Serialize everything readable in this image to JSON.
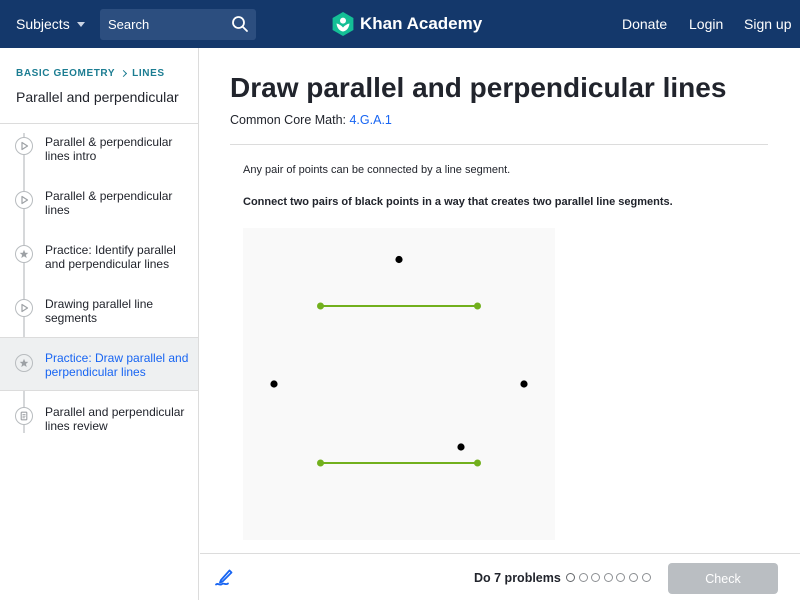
{
  "nav": {
    "subjects_label": "Subjects",
    "search_placeholder": "Search",
    "logo_text": "Khan Academy",
    "donate_label": "Donate",
    "login_label": "Login",
    "signup_label": "Sign up"
  },
  "sidebar": {
    "breadcrumb": [
      "BASIC GEOMETRY",
      "LINES"
    ],
    "unit_title": "Parallel and perpendicular",
    "items": [
      {
        "label": "Parallel & perpendicular lines intro",
        "icon": "play-icon",
        "active": false
      },
      {
        "label": "Parallel & perpendicular lines",
        "icon": "play-icon",
        "active": false
      },
      {
        "label": "Practice: Identify parallel and perpendicular lines",
        "icon": "star-icon",
        "active": false
      },
      {
        "label": "Drawing parallel line segments",
        "icon": "play-icon",
        "active": false
      },
      {
        "label": "Practice: Draw parallel and perpendicular lines",
        "icon": "star-icon",
        "active": true
      },
      {
        "label": "Parallel and perpendicular lines review",
        "icon": "document-icon",
        "active": false
      }
    ]
  },
  "main": {
    "title": "Draw parallel and perpendicular lines",
    "standard_prefix": "Common Core Math: ",
    "standard_code": "4.G.A.1",
    "intro": "Any pair of points can be connected by a line segment.",
    "instruction": "Connect two pairs of black points in a way that creates two parallel line segments."
  },
  "footer": {
    "do_problems": "Do 7 problems",
    "problem_count": 7,
    "current_problem": 1,
    "check_label": "Check"
  },
  "colors": {
    "nav_bg": "#14386b",
    "accent_blue": "#1865f2",
    "segment_green": "#72b01d",
    "point_black": "#000000",
    "check_disabled": "#babec2"
  }
}
